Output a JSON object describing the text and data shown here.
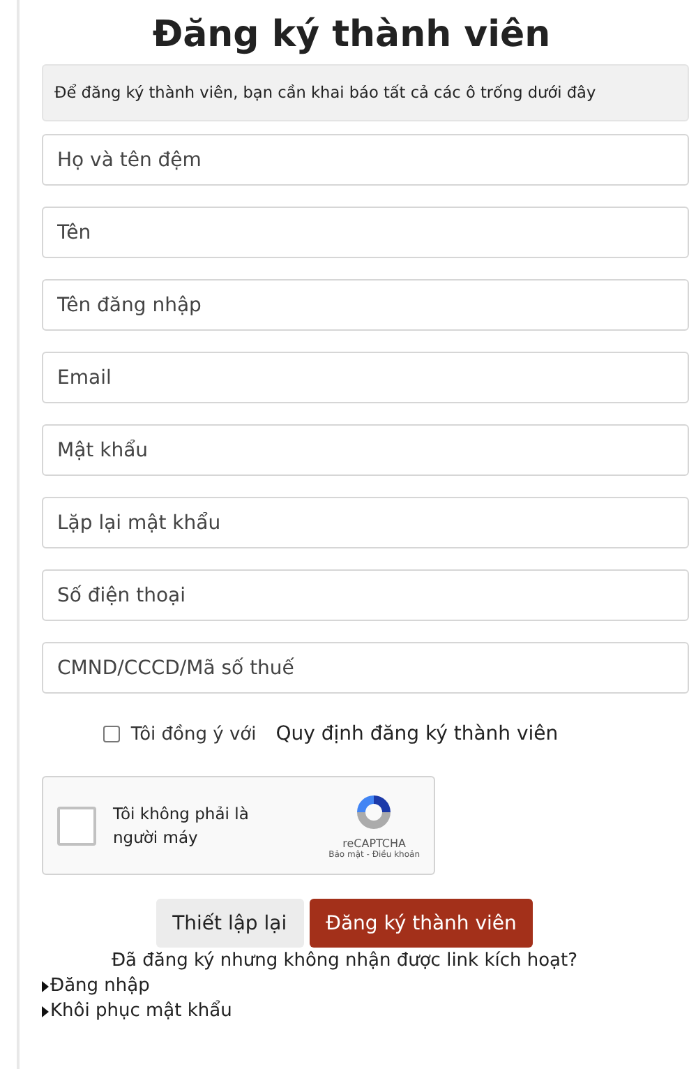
{
  "title": "Đăng ký thành viên",
  "notice": "Để đăng ký thành viên, bạn cần khai báo tất cả các ô trống dưới đây",
  "fields": [
    {
      "placeholder": "Họ và tên đệm"
    },
    {
      "placeholder": "Tên"
    },
    {
      "placeholder": "Tên đăng nhập"
    },
    {
      "placeholder": "Email"
    },
    {
      "placeholder": "Mật khẩu"
    },
    {
      "placeholder": "Lặp lại mật khẩu"
    },
    {
      "placeholder": "Số điện thoại"
    },
    {
      "placeholder": "CMND/CCCD/Mã số thuế"
    }
  ],
  "agree": {
    "label": "Tôi đồng ý với",
    "link": "Quy định đăng ký thành viên",
    "checked": false
  },
  "captcha": {
    "label": "Tôi không phải là người máy",
    "brand": "reCAPTCHA",
    "terms": "Bảo mật - Điều khoản",
    "checked": false
  },
  "buttons": [
    {
      "label": "Thiết lập lại",
      "kind": "secondary"
    },
    {
      "label": "Đăng ký thành viên",
      "kind": "primary"
    }
  ],
  "resend_link": "Đã đăng ký nhưng không nhận được link kích hoạt?",
  "links": [
    "Đăng nhập",
    "Khôi phục mật khẩu"
  ]
}
